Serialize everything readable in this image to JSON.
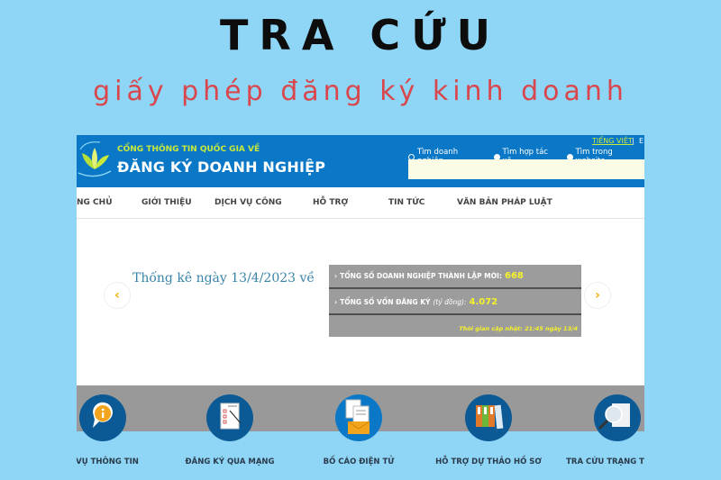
{
  "banner": {
    "title": "TRA CỨU",
    "subtitle": "giấy phép đăng ký kinh doanh"
  },
  "site": {
    "brand_top": "CỔNG THÔNG TIN QUỐC GIA VỀ",
    "brand_main": "ĐĂNG KÝ DOANH NGHIỆP",
    "language": "TIẾNG VIỆT",
    "language_sep": "|",
    "language_other": "E",
    "search_options": [
      {
        "label": "Tìm doanh nghiệp",
        "selected": true
      },
      {
        "label": "Tìm hợp tác xã",
        "selected": false
      },
      {
        "label": "Tìm trong website",
        "selected": false
      }
    ],
    "search_value": ""
  },
  "nav": {
    "items": [
      "NG CHỦ",
      "GIỚI THIỆU",
      "DỊCH VỤ CÔNG",
      "HỖ TRỢ",
      "TIN TỨC",
      "VĂN BẢN PHÁP LUẬT"
    ]
  },
  "slider": {
    "prev_icon": "‹",
    "next_icon": "›",
    "caption": "Thống kê ngày 13/4/2023 về",
    "stats": [
      {
        "label": "TỔNG SỐ DOANH NGHIỆP THÀNH LẬP MỚI:",
        "unit": "",
        "value": "668"
      },
      {
        "label": "TỔNG SỐ VỐN ĐĂNG KÝ",
        "unit": "(tỷ đồng):",
        "value": "4.072"
      }
    ],
    "updated": "Thời gian cập nhật: 21:45 ngày 13/4"
  },
  "services": [
    {
      "label": "H VỤ THÔNG TIN",
      "icon": "info-bubble-icon"
    },
    {
      "label": "ĐĂNG KÝ QUA MẠNG",
      "icon": "checklist-form-icon"
    },
    {
      "label": "BỐ CÁO ĐIỆN TỬ",
      "icon": "document-envelope-icon"
    },
    {
      "label": "HỖ TRỢ DỰ THẢO HỒ SƠ",
      "icon": "binders-icon"
    },
    {
      "label": "TRA CỨU TRẠNG THÁI H",
      "icon": "magnifier-document-icon"
    }
  ],
  "colors": {
    "page_bg": "#8fd6f6",
    "header_blue": "#0a78c6",
    "brand_green": "#c9ea3b",
    "subtitle_red": "#d9474d",
    "stat_yellow": "#f5f229",
    "stat_gray": "#9c9c9c",
    "service_circle": "#0c5a95"
  }
}
